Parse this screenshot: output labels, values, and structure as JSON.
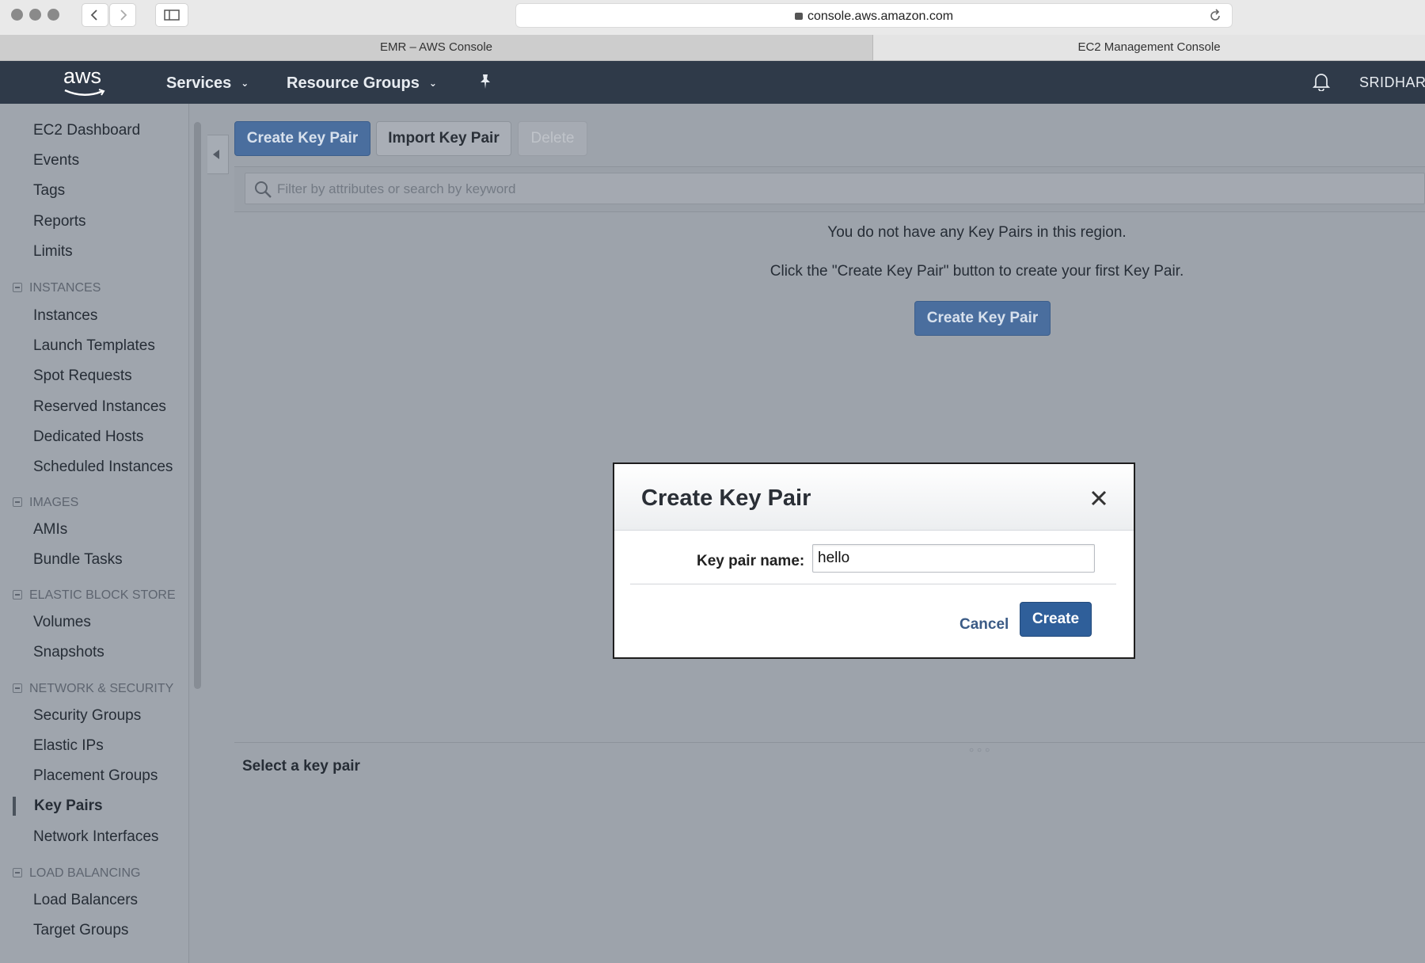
{
  "browser": {
    "url": "console.aws.amazon.com",
    "tabs": [
      "EMR – AWS Console",
      "EC2 Management Console"
    ]
  },
  "topnav": {
    "logo": "aws",
    "services": "Services",
    "resource_groups": "Resource Groups",
    "user": "SRIDHAR"
  },
  "sidebar": {
    "items_top": [
      "EC2 Dashboard",
      "Events",
      "Tags",
      "Reports",
      "Limits"
    ],
    "sections": [
      {
        "title": "INSTANCES",
        "items": [
          "Instances",
          "Launch Templates",
          "Spot Requests",
          "Reserved Instances",
          "Dedicated Hosts",
          "Scheduled Instances"
        ]
      },
      {
        "title": "IMAGES",
        "items": [
          "AMIs",
          "Bundle Tasks"
        ]
      },
      {
        "title": "ELASTIC BLOCK STORE",
        "items": [
          "Volumes",
          "Snapshots"
        ]
      },
      {
        "title": "NETWORK & SECURITY",
        "items": [
          "Security Groups",
          "Elastic IPs",
          "Placement Groups",
          "Key Pairs",
          "Network Interfaces"
        ]
      },
      {
        "title": "LOAD BALANCING",
        "items": [
          "Load Balancers",
          "Target Groups"
        ]
      }
    ],
    "active_item": "Key Pairs"
  },
  "toolbar": {
    "create_label": "Create Key Pair",
    "import_label": "Import Key Pair",
    "delete_label": "Delete"
  },
  "filter": {
    "placeholder": "Filter by attributes or search by keyword"
  },
  "empty_state": {
    "line1": "You do not have any Key Pairs in this region.",
    "line2": "Click the \"Create Key Pair\" button to create your first Key Pair.",
    "button": "Create Key Pair"
  },
  "detail": {
    "title": "Select a key pair"
  },
  "modal": {
    "title": "Create Key Pair",
    "field_label": "Key pair name:",
    "field_value": "hello",
    "cancel_label": "Cancel",
    "create_label": "Create"
  }
}
